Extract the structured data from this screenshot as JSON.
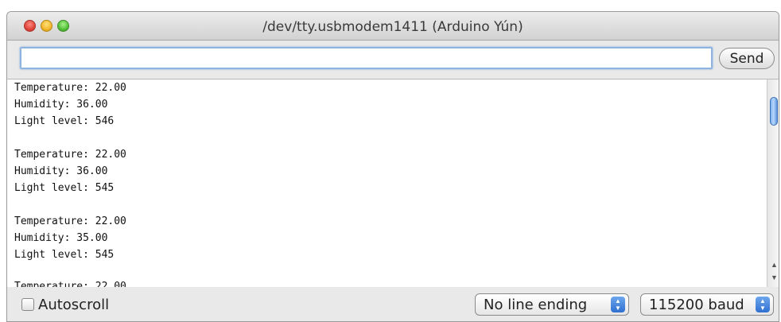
{
  "window": {
    "title": "/dev/tty.usbmodem1411 (Arduino Yún)"
  },
  "input": {
    "value": "",
    "placeholder": ""
  },
  "send_button": {
    "label": "Send"
  },
  "output": {
    "lines": [
      "Temperature: 22.00",
      "Humidity: 36.00",
      "Light level: 546",
      "",
      "Temperature: 22.00",
      "Humidity: 36.00",
      "Light level: 545",
      "",
      "Temperature: 22.00",
      "Humidity: 35.00",
      "Light level: 545",
      "",
      "Temperature: 22.00"
    ]
  },
  "footer": {
    "autoscroll_label": "Autoscroll",
    "autoscroll_checked": false,
    "line_ending": "No line ending",
    "baud": "115200 baud"
  },
  "icons": {
    "close": "close-icon",
    "minimize": "minimize-icon",
    "zoom": "zoom-icon",
    "scroll_up": "arrow-up-icon",
    "scroll_down": "arrow-down-icon",
    "stepper": "up-down-stepper-icon"
  },
  "colors": {
    "close": "#e0443a",
    "minimize": "#f2b72e",
    "zoom": "#55c23a",
    "focus_ring": "#8fb4e0",
    "stepper": "#2f6fd0"
  }
}
